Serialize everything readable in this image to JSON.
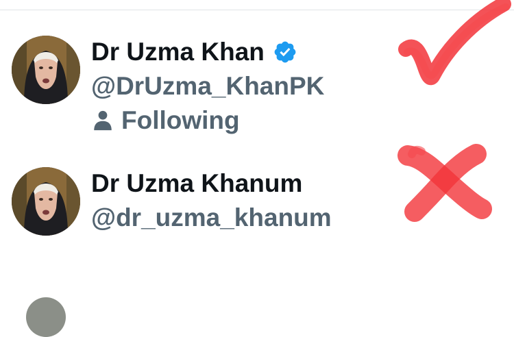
{
  "accounts": [
    {
      "display_name": "Dr Uzma Khan",
      "handle": "@DrUzma_KhanPK",
      "verified": true,
      "follow_status": "Following",
      "annotation": "checkmark-icon"
    },
    {
      "display_name": "Dr Uzma Khanum",
      "handle": "@dr_uzma_khanum",
      "verified": false,
      "follow_status": "",
      "annotation": "cross-mark-icon"
    }
  ],
  "colors": {
    "name": "#0f1419",
    "secondary": "#536471",
    "verified_badge": "#1d9bf0",
    "annotation_red": "#f2343a"
  }
}
